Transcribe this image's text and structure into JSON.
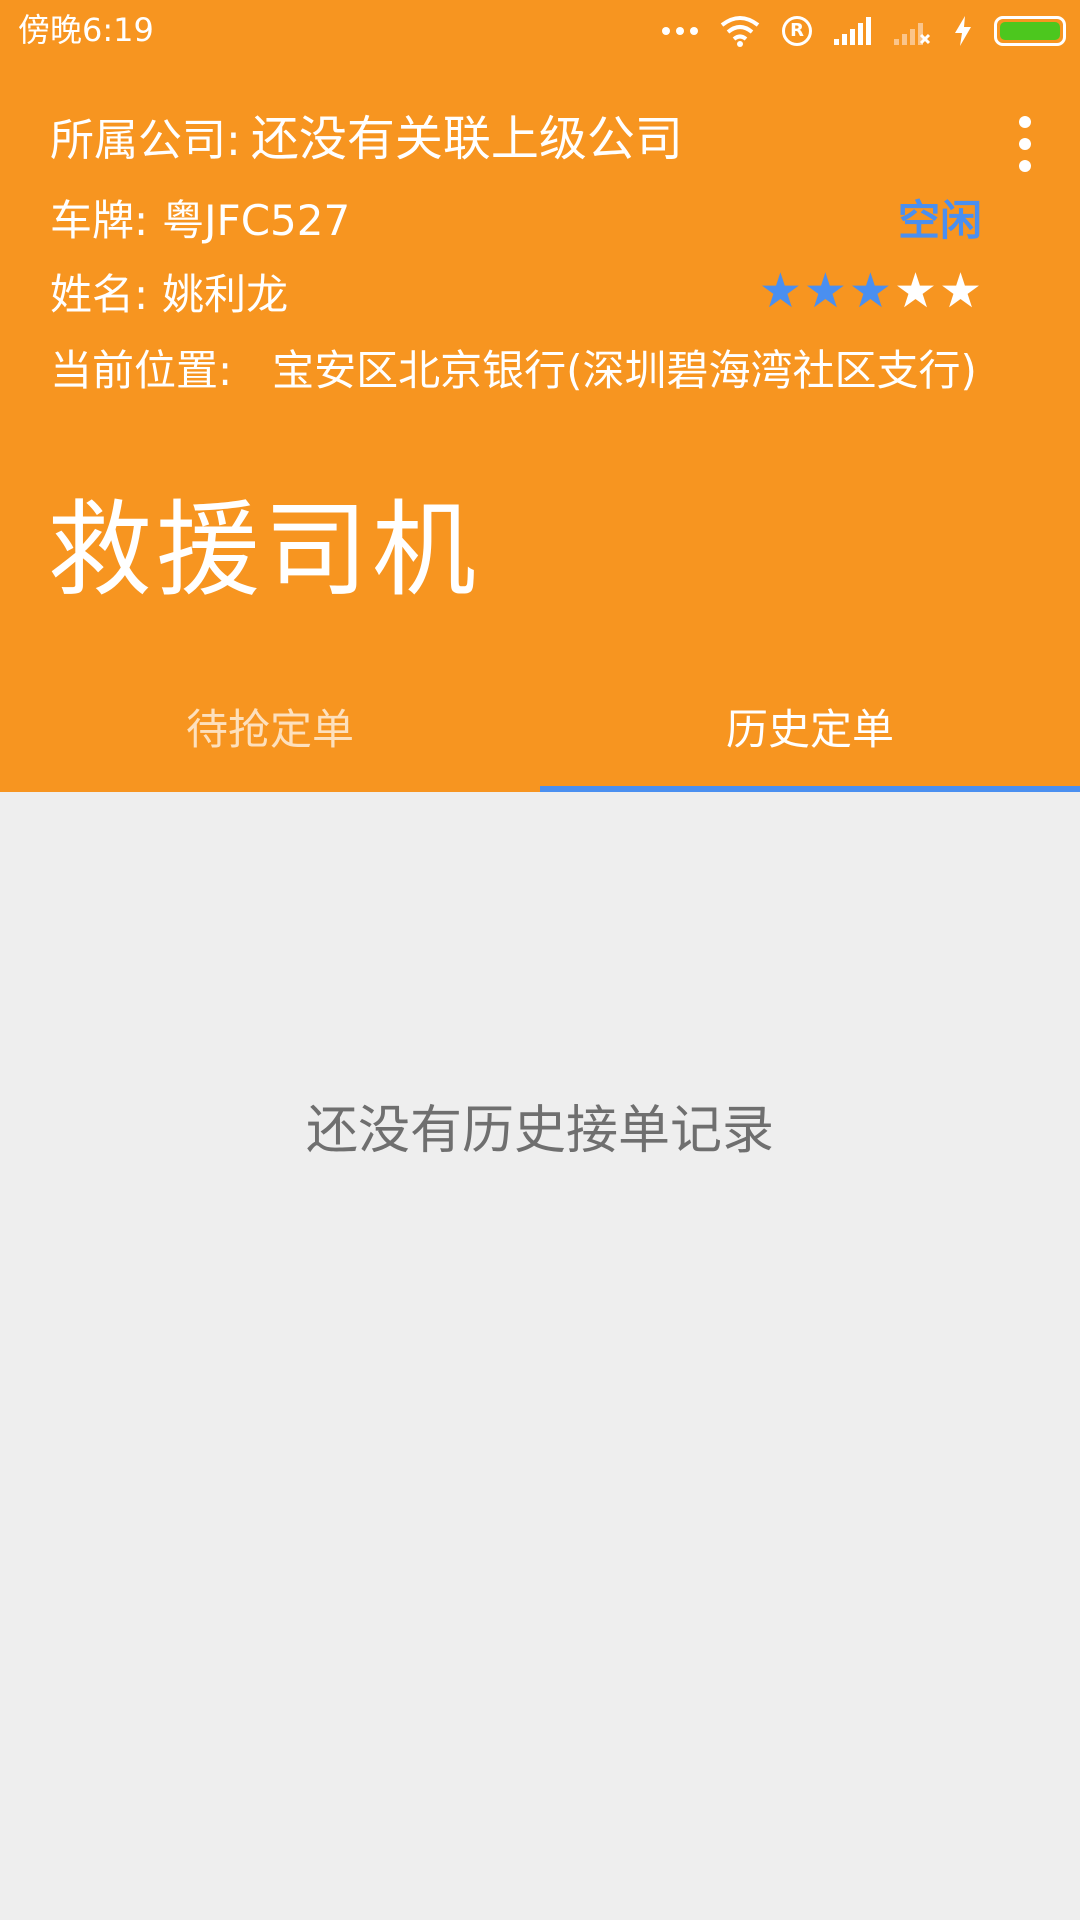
{
  "statusbar": {
    "time": "傍晚6:19",
    "registered_mark": "R",
    "icons": [
      "dots-icon",
      "wifi-icon",
      "registered-icon",
      "signal-icon",
      "signal-no-service-icon",
      "charging-icon",
      "battery-icon"
    ],
    "battery_color": "#4cc71e"
  },
  "driver": {
    "company_label": "所属公司:",
    "company_value": "还没有关联上级公司",
    "plate_label": "车牌:",
    "plate_value": "粤JFC527",
    "name_label": "姓名:",
    "name_value": "姚利龙",
    "location_label": "当前位置:",
    "location_value": "宝安区北京银行(深圳碧海湾社区支行)",
    "status": "空闲",
    "rating": 3,
    "rating_max": 5
  },
  "app": {
    "title": "救援司机"
  },
  "tabs": [
    {
      "label": "待抢定单",
      "active": false
    },
    {
      "label": "历史定单",
      "active": true
    }
  ],
  "content": {
    "empty_message": "还没有历史接单记录"
  },
  "colors": {
    "primary": "#f79520",
    "accent": "#4a8ff0",
    "background": "#eeeeee"
  }
}
